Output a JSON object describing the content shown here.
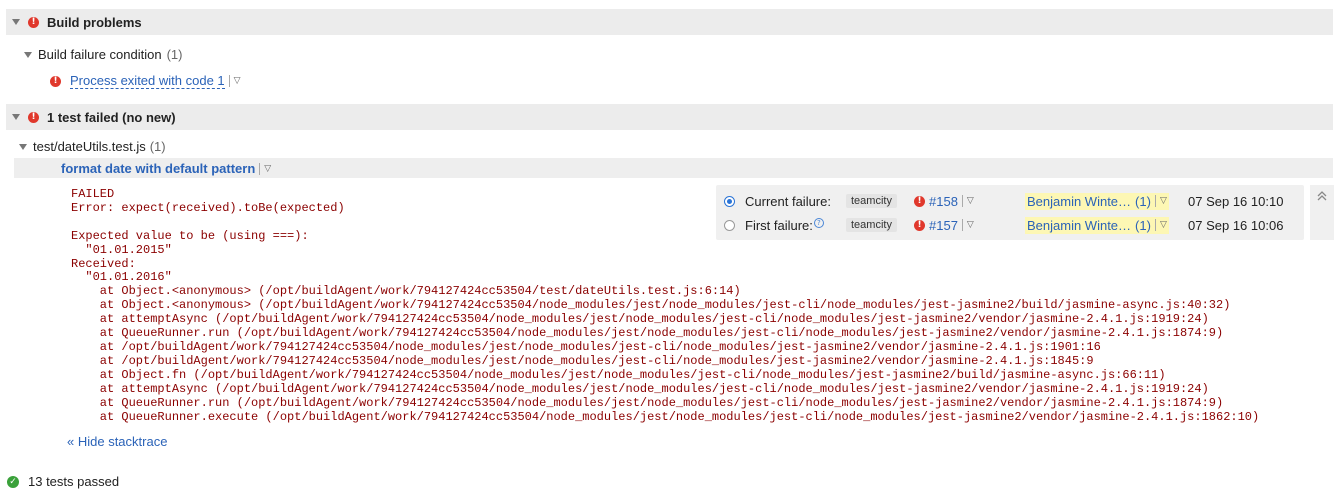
{
  "build_problems": {
    "title": "Build problems",
    "condition_label": "Build failure condition",
    "condition_count": "(1)",
    "problem_link": "Process exited with code 1"
  },
  "tests_failed": {
    "title": "1 test failed (no new)",
    "file": "test/dateUtils.test.js",
    "file_count": "(1)",
    "test_name": "format date with default pattern",
    "stacktrace": "FAILED\nError: expect(received).toBe(expected)\n\nExpected value to be (using ===):\n  \"01.01.2015\"\nReceived:\n  \"01.01.2016\"\n    at Object.<anonymous> (/opt/buildAgent/work/794127424cc53504/test/dateUtils.test.js:6:14)\n    at Object.<anonymous> (/opt/buildAgent/work/794127424cc53504/node_modules/jest/node_modules/jest-cli/node_modules/jest-jasmine2/build/jasmine-async.js:40:32)\n    at attemptAsync (/opt/buildAgent/work/794127424cc53504/node_modules/jest/node_modules/jest-cli/node_modules/jest-jasmine2/vendor/jasmine-2.4.1.js:1919:24)\n    at QueueRunner.run (/opt/buildAgent/work/794127424cc53504/node_modules/jest/node_modules/jest-cli/node_modules/jest-jasmine2/vendor/jasmine-2.4.1.js:1874:9)\n    at /opt/buildAgent/work/794127424cc53504/node_modules/jest/node_modules/jest-cli/node_modules/jest-jasmine2/vendor/jasmine-2.4.1.js:1901:16\n    at /opt/buildAgent/work/794127424cc53504/node_modules/jest/node_modules/jest-cli/node_modules/jest-jasmine2/vendor/jasmine-2.4.1.js:1845:9\n    at Object.fn (/opt/buildAgent/work/794127424cc53504/node_modules/jest/node_modules/jest-cli/node_modules/jest-jasmine2/build/jasmine-async.js:66:11)\n    at attemptAsync (/opt/buildAgent/work/794127424cc53504/node_modules/jest/node_modules/jest-cli/node_modules/jest-jasmine2/vendor/jasmine-2.4.1.js:1919:24)\n    at QueueRunner.run (/opt/buildAgent/work/794127424cc53504/node_modules/jest/node_modules/jest-cli/node_modules/jest-jasmine2/vendor/jasmine-2.4.1.js:1874:9)\n    at QueueRunner.execute (/opt/buildAgent/work/794127424cc53504/node_modules/jest/node_modules/jest-cli/node_modules/jest-jasmine2/vendor/jasmine-2.4.1.js:1862:10)",
    "hide_stacktrace": "« Hide stacktrace"
  },
  "history": {
    "current": {
      "label": "Current failure:",
      "agent": "teamcity",
      "build": "#158",
      "author": "Benjamin Winte…",
      "author_count": "(1)",
      "date": "07 Sep 16 10:10"
    },
    "first": {
      "label": "First failure:",
      "agent": "teamcity",
      "build": "#157",
      "author": "Benjamin Winte…",
      "author_count": "(1)",
      "date": "07 Sep 16 10:06"
    }
  },
  "passed": {
    "label": "13 tests passed"
  },
  "colors": {
    "error_red": "#e0382c",
    "link_blue": "#2b63b8",
    "stack_red": "#8b0000",
    "success_green": "#3aa13a",
    "author_highlight": "#fdf7b4"
  },
  "icons": {
    "error": "error-circle-icon",
    "success": "check-circle-icon",
    "collapse": "double-chevron-up-icon",
    "help": "help-icon"
  }
}
